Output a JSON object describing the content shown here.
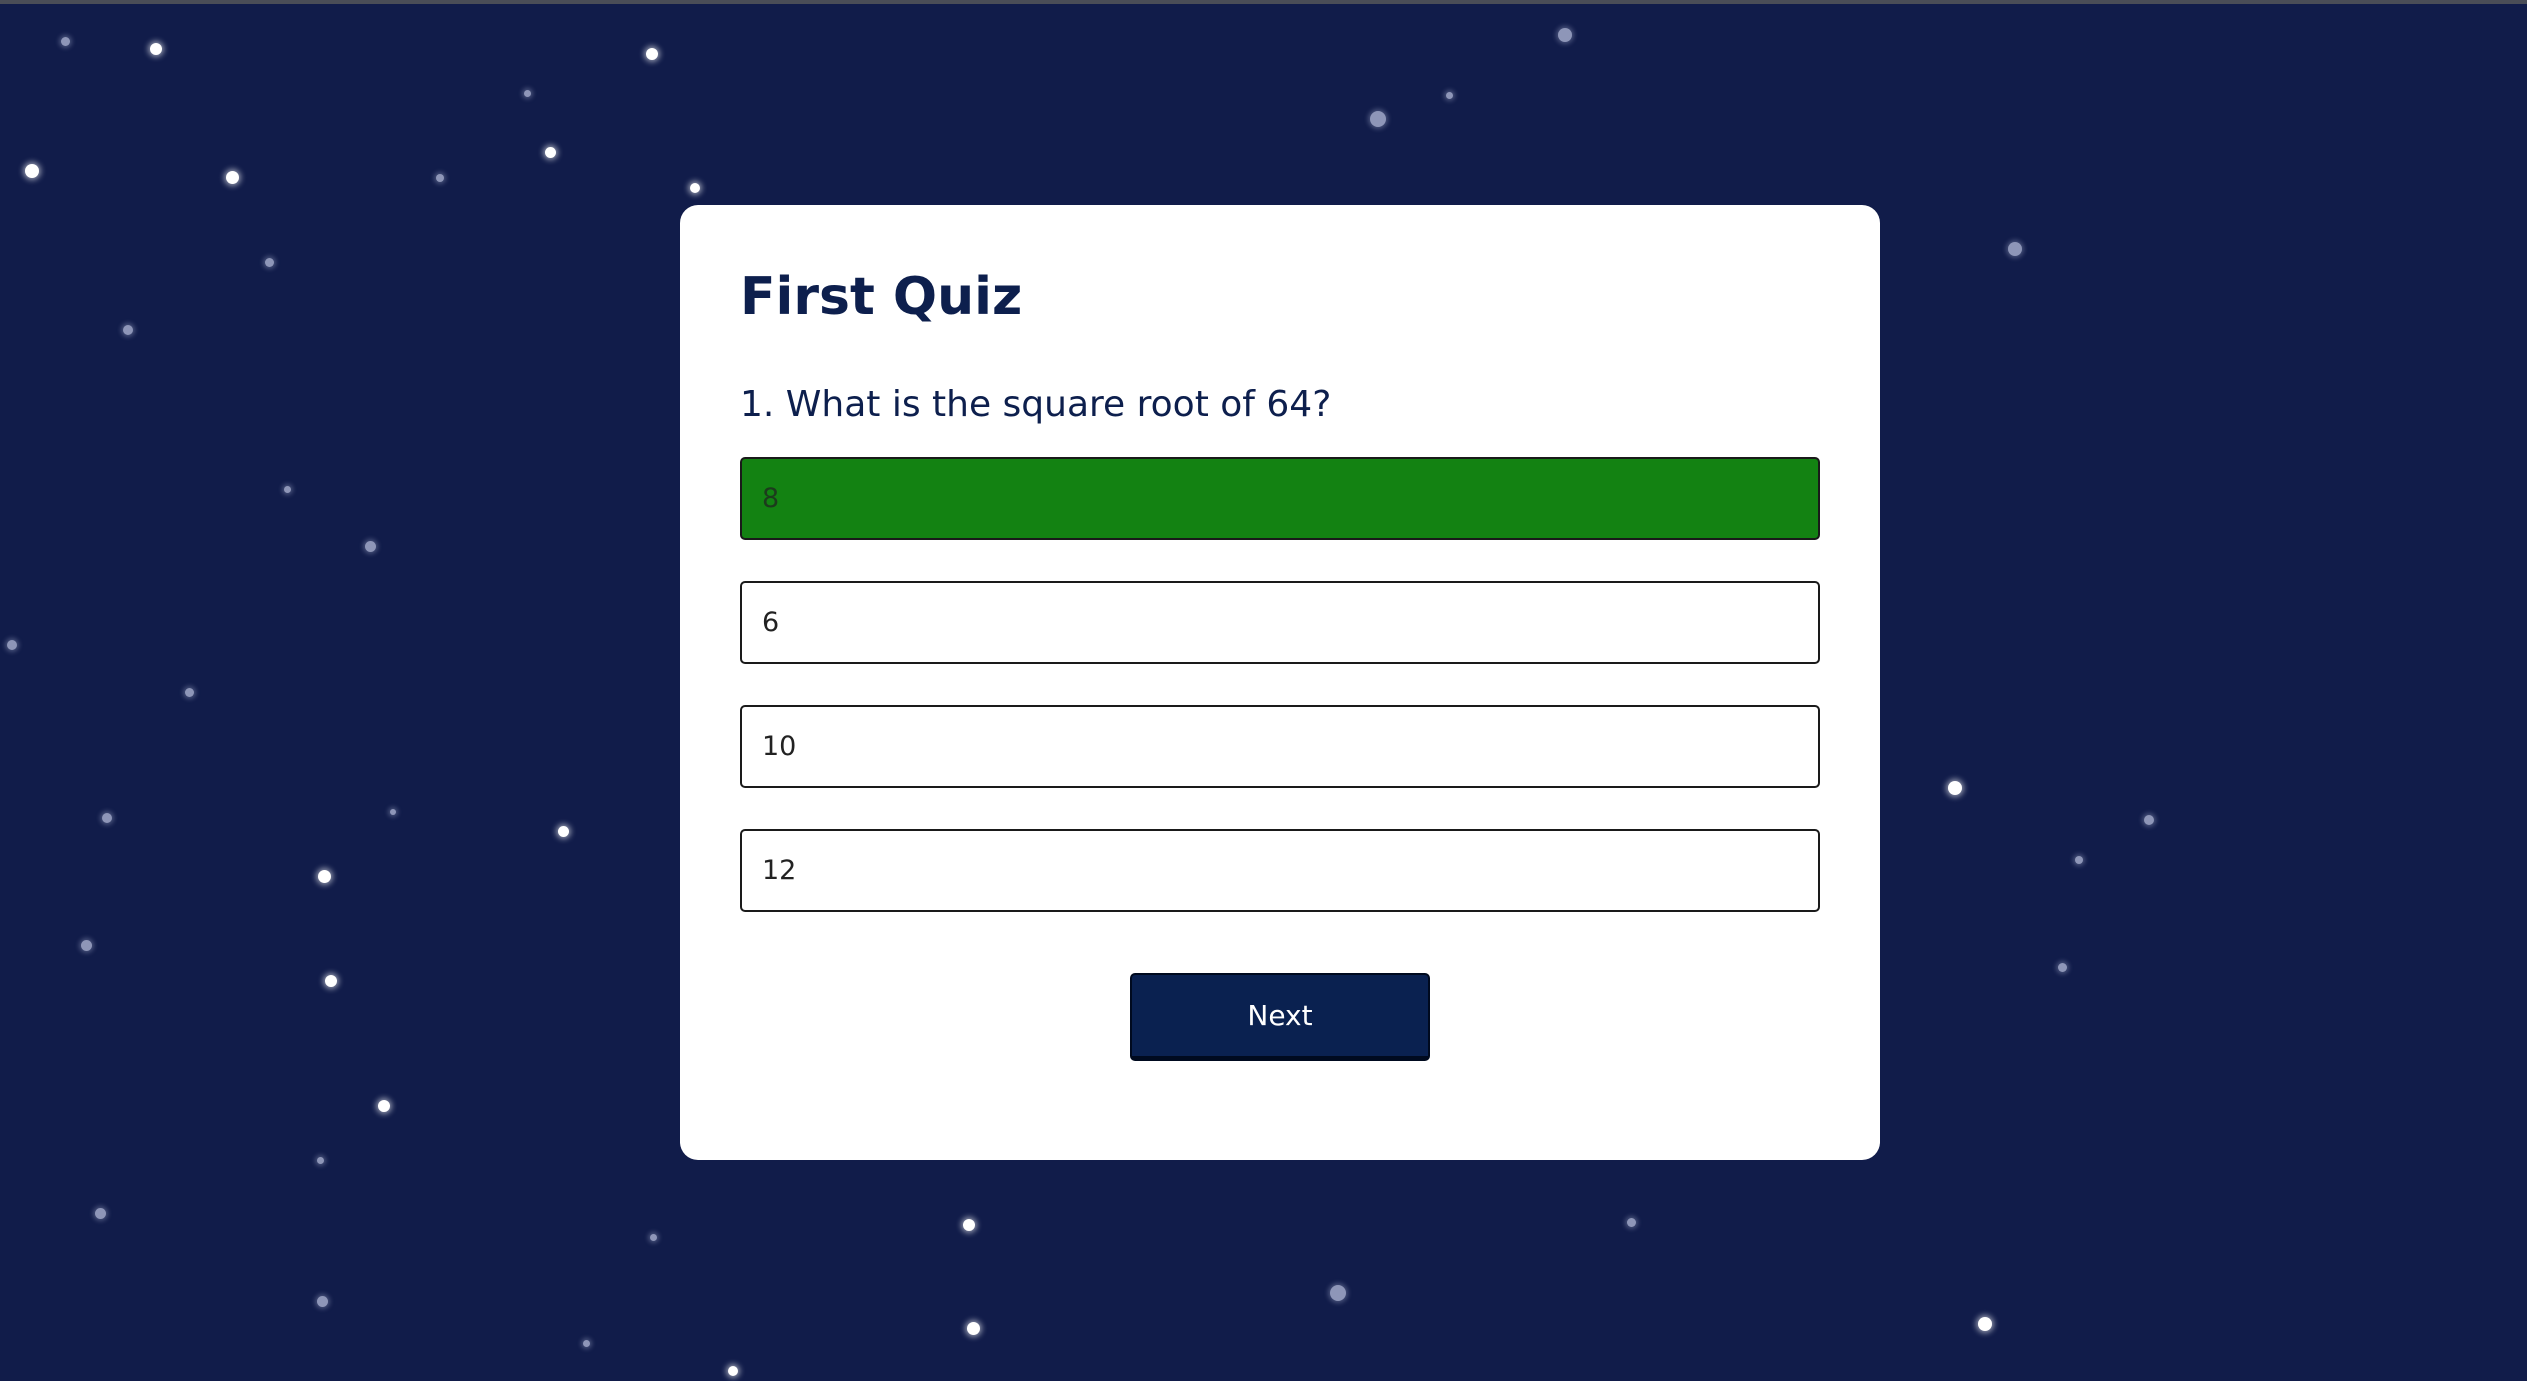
{
  "quiz": {
    "title": "First Quiz",
    "question": "1. What is the square root of 64?",
    "answers": [
      {
        "label": "8",
        "state": "correct"
      },
      {
        "label": "6",
        "state": "neutral"
      },
      {
        "label": "10",
        "state": "neutral"
      },
      {
        "label": "12",
        "state": "neutral"
      }
    ],
    "next_label": "Next"
  },
  "colors": {
    "background": "#111c4a",
    "card": "#ffffff",
    "title_text": "#0d1f4d",
    "correct_answer": "#138212",
    "button": "#0a2150"
  }
}
